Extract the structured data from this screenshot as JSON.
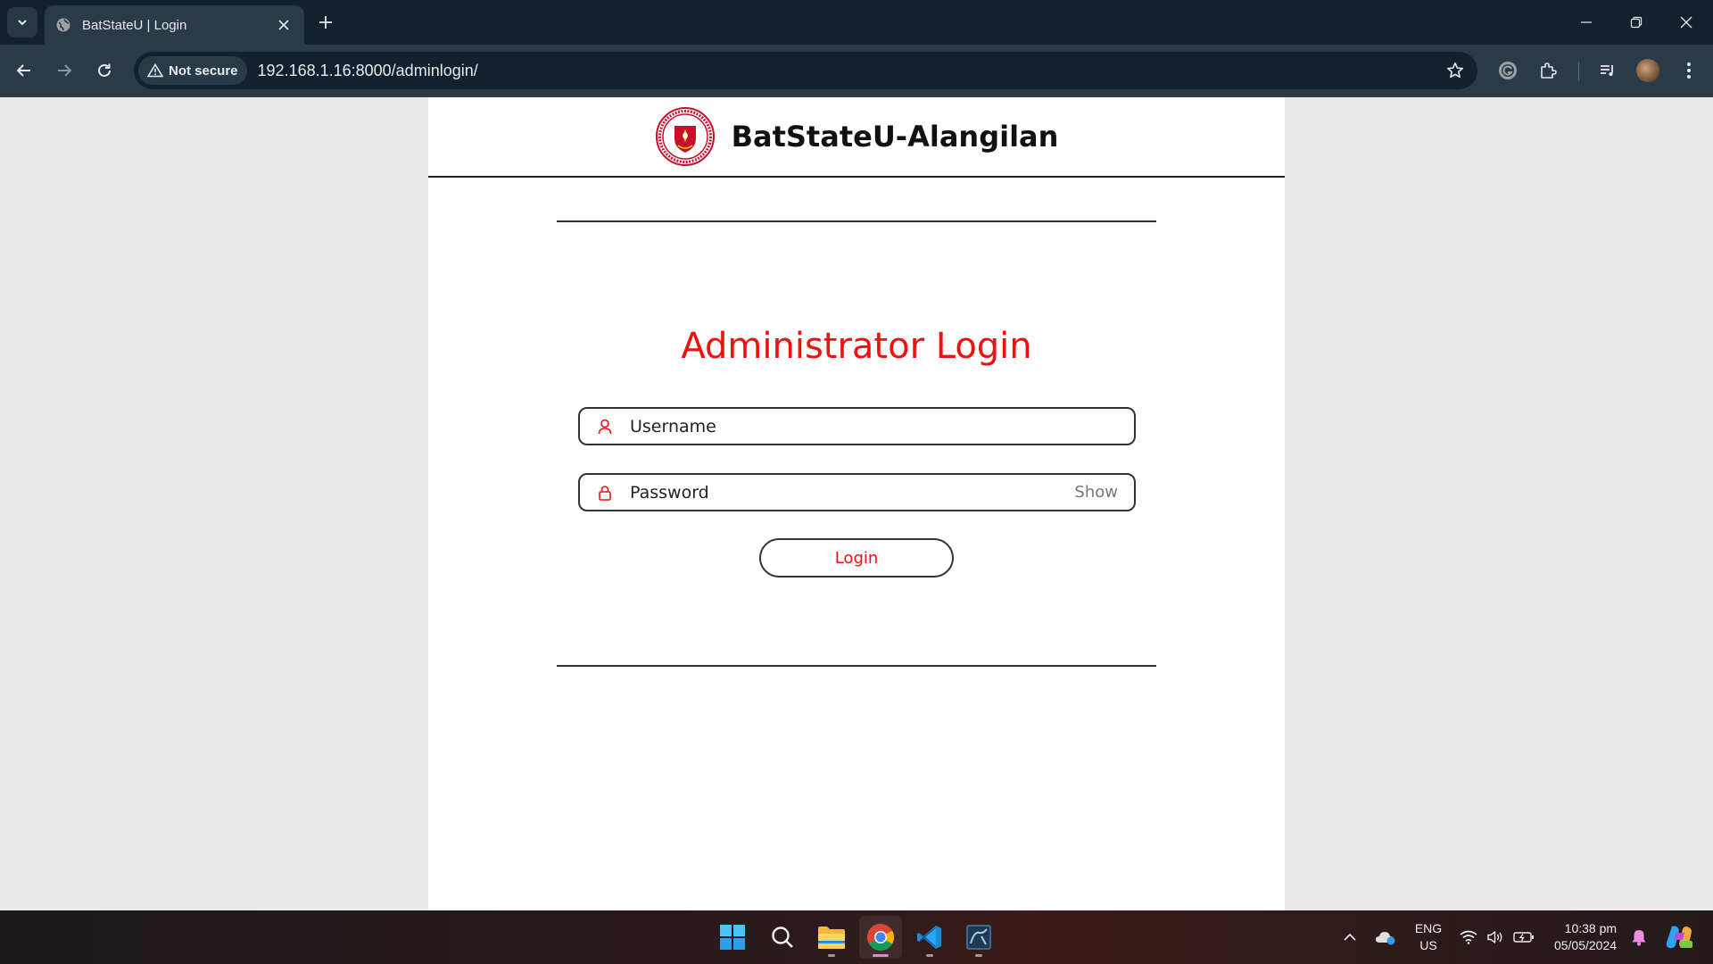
{
  "browser": {
    "tab_title": "BatStateU | Login",
    "security_label": "Not secure",
    "url": "192.168.1.16:8000/adminlogin/"
  },
  "site": {
    "title": "BatStateU-Alangilan"
  },
  "login": {
    "heading": "Administrator Login",
    "username_placeholder": "Username",
    "password_placeholder": "Password",
    "show_label": "Show",
    "button_label": "Login"
  },
  "taskbar": {
    "language_line1": "ENG",
    "language_line2": "US",
    "time": "10:38 pm",
    "date": "05/05/2024"
  },
  "colors": {
    "accent_red": "#ee1111",
    "chrome_dark": "#13202e",
    "chrome_toolbar": "#2b3a49"
  }
}
